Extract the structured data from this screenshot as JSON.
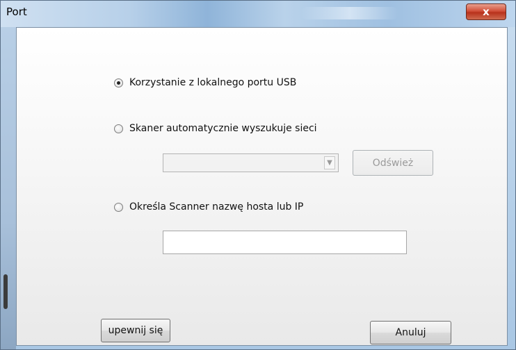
{
  "window": {
    "title": "Port",
    "close_glyph": "x"
  },
  "options": {
    "usb_label": "Korzystanie z lokalnego portu USB",
    "usb_selected": true,
    "network_search_label": "Skaner automatycznie wyszukuje sieci",
    "network_search_selected": false,
    "hostname_label": "Określa Scanner nazwę hosta lub IP",
    "hostname_selected": false
  },
  "network": {
    "scanner_select_value": "",
    "refresh_label": "Odśwież",
    "refresh_enabled": false
  },
  "hostname": {
    "value": ""
  },
  "footer": {
    "ok_label": "upewnij się",
    "cancel_label": "Anuluj"
  },
  "icons": {
    "close": "close-icon",
    "combo_arrow": "chevron-down-icon"
  },
  "colors": {
    "close_button": "#c8422b",
    "title_bar": "#b9d2ea",
    "client_bg": "#f7f7f7"
  }
}
